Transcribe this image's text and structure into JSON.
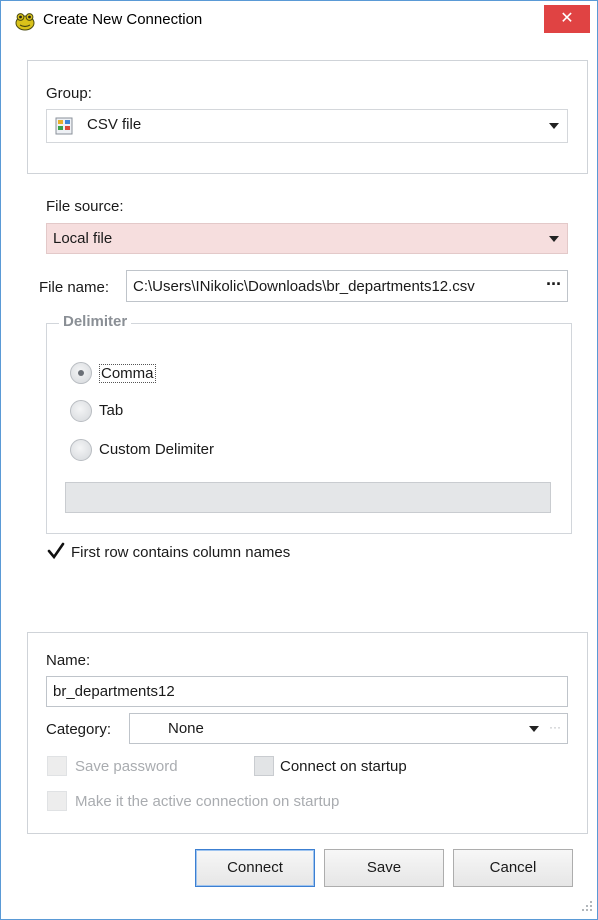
{
  "window": {
    "title": "Create New Connection",
    "close_glyph": "✕"
  },
  "group": {
    "label": "Group:",
    "value": "CSV file",
    "icon": "csv-file-icon"
  },
  "file_source": {
    "label": "File source:",
    "value": "Local file",
    "highlight_color": "#f6dede"
  },
  "file_name": {
    "label": "File name:",
    "value": "C:\\Users\\INikolic\\Downloads\\br_departments12.csv",
    "browse_glyph": "···"
  },
  "delimiter": {
    "legend": "Delimiter",
    "options": [
      {
        "label": "Comma",
        "checked": true
      },
      {
        "label": "Tab",
        "checked": false
      },
      {
        "label": "Custom Delimiter",
        "checked": false
      }
    ],
    "custom_value": ""
  },
  "first_row": {
    "label": "First row contains column names",
    "checked": true
  },
  "name": {
    "label": "Name:",
    "value": "br_departments12"
  },
  "category": {
    "label": "Category:",
    "value": "None",
    "more_glyph": "···"
  },
  "save_password": {
    "label": "Save password",
    "enabled": false
  },
  "connect_on_startup": {
    "label": "Connect on startup",
    "checked": false
  },
  "make_active": {
    "label": "Make it the active connection on startup",
    "enabled": false
  },
  "buttons": {
    "connect": "Connect",
    "save": "Save",
    "cancel": "Cancel"
  },
  "colors": {
    "accent": "#3c7fd1",
    "close": "#e04343"
  }
}
